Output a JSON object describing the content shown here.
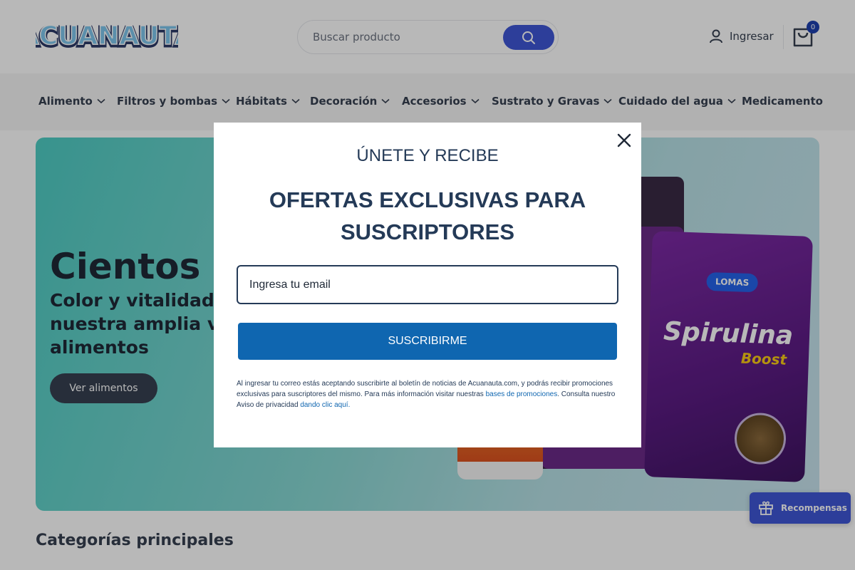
{
  "header": {
    "logo_text": "ACUANAUTA",
    "search_placeholder": "Buscar producto",
    "login_label": "Ingresar",
    "cart_count": "0"
  },
  "nav": {
    "items": [
      {
        "label": "Alimento",
        "has_dropdown": true
      },
      {
        "label": "Filtros y bombas",
        "has_dropdown": true
      },
      {
        "label": "Hábitats",
        "has_dropdown": true
      },
      {
        "label": "Decoración",
        "has_dropdown": true
      },
      {
        "label": "Accesorios",
        "has_dropdown": true
      },
      {
        "label": "Sustrato y Gravas",
        "has_dropdown": true
      },
      {
        "label": "Cuidado del agua",
        "has_dropdown": true
      },
      {
        "label": "Medicamento",
        "has_dropdown": false
      }
    ]
  },
  "hero": {
    "title": "Cientos de",
    "subtitle": "Color y vitalidad con nuestra amplia variedad de alimentos",
    "button_label": "Ver alimentos",
    "product_brand": "LOMAS",
    "product_name": "Spirulina",
    "product_variant": "Boost"
  },
  "sections": {
    "categories_title": "Categorías principales"
  },
  "modal": {
    "kicker": "ÚNETE Y RECIBE",
    "headline": "OFERTAS EXCLUSIVAS PARA SUSCRIPTORES",
    "email_placeholder": "Ingresa tu email",
    "submit_label": "SUSCRIBIRME",
    "legal_prefix": "Al ingresar tu correo estás aceptando suscribirte al boletín de noticias de Acuanauta.com, y podrás recibir promociones exclusivas para suscriptores del mismo. Para más información visitar nuestras ",
    "legal_link1": "bases de promociones",
    "legal_middle": ". Consulta nuestro Aviso de privacidad ",
    "legal_link2": "dando clic aquí."
  },
  "rewards": {
    "label": "Recompensas"
  },
  "colors": {
    "brand_blue": "#3f56d6",
    "modal_text": "#243a57",
    "submit_blue": "#0f66b0",
    "hero_teal": "#4ecdc4"
  }
}
